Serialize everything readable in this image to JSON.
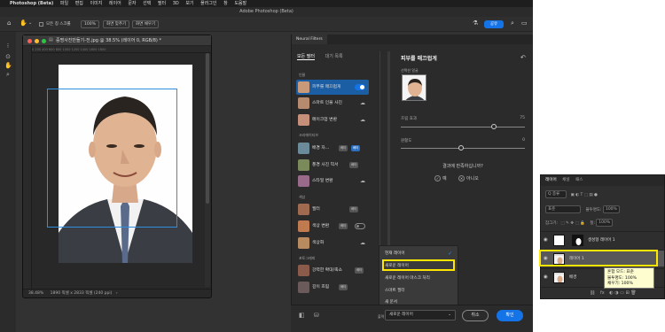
{
  "menubar": {
    "app_name": "Photoshop (Beta)",
    "items": [
      "파일",
      "편집",
      "이미지",
      "레이어",
      "문자",
      "선택",
      "필터",
      "3D",
      "보기",
      "플러그인",
      "창",
      "도움말"
    ]
  },
  "window": {
    "title": "Adobe Photoshop (Beta)"
  },
  "options_bar": {
    "select_mask": "모든 칭 스크롤",
    "zoom": "100%",
    "fit_screen": "화면 맞추기",
    "fill_screen": "화면 채우기",
    "share": "공유"
  },
  "document": {
    "title": "증명사진만들기-전.jpg @ 38.5% (레이어 0, RGB/8) *",
    "ruler_marks": "0 200 400 600 800 1000 1200 1400 1600 1800",
    "status_zoom": "38.48%",
    "status_info": "1890 픽셀 x 2833 픽셀 (240 ppi)"
  },
  "neural_filters": {
    "tab_label": "Neural Filters",
    "filter_tabs": [
      "모든 필터",
      "대기 목록"
    ],
    "categories": {
      "portrait": "인물",
      "creative": "크리에이티브",
      "color": "색상",
      "photography": "포토그래피"
    },
    "filters": [
      {
        "name": "피부를 매끄럽게"
      },
      {
        "name": "스마트 인물 사진"
      },
      {
        "name": "메이크업 변환"
      },
      {
        "name": "배경 자...",
        "badge": "베타"
      },
      {
        "name": "풍경 사진 믹서",
        "badge": "베타"
      },
      {
        "name": "스타일 변환"
      },
      {
        "name": "필터",
        "badge": "베타"
      },
      {
        "name": "색상 변환",
        "badge": "베타"
      },
      {
        "name": "색상화"
      },
      {
        "name": "강력한 확대/축소",
        "badge": "베타"
      },
      {
        "name": "깊이 흐림",
        "badge": "베타"
      }
    ],
    "extra_badge": "베타",
    "detail": {
      "title": "피부를 매끄럽게",
      "selected_face_label": "선택한 얼굴",
      "slider1_label": "흐림 효과",
      "slider1_value": "75",
      "slider2_label": "원활도",
      "slider2_value": "0",
      "question": "결과에 만족하십니까?",
      "yes": "예",
      "no": "아니오"
    },
    "output_dropdown": {
      "options": [
        "현재 레이어",
        "새로운 레이어",
        "새로운 레이어 마스크 처리",
        "스마트 필터",
        "새 문서"
      ],
      "checked": "현재 레이어",
      "highlighted": "새로운 레이어"
    },
    "bottom": {
      "output_label": "출력",
      "output_value": "새로운 레이어",
      "cancel": "취소",
      "ok": "확인"
    }
  },
  "layers_panel": {
    "tabs": [
      "레이어",
      "채널",
      "패스"
    ],
    "kind_label": "Q 종류",
    "blend_mode": "표준",
    "opacity_label": "불투명도:",
    "opacity_value": "100%",
    "lock_label": "잠그기:",
    "fill_label": "칠:",
    "fill_value": "100%",
    "layers": [
      {
        "name": "생성형 레이어 1"
      },
      {
        "name": "레이어 1"
      },
      {
        "name": "배경"
      }
    ],
    "tooltip": [
      "혼합 모드: 표준",
      "불투명도: 100%",
      "채우기: 100%"
    ],
    "footer_icons": "fx"
  }
}
